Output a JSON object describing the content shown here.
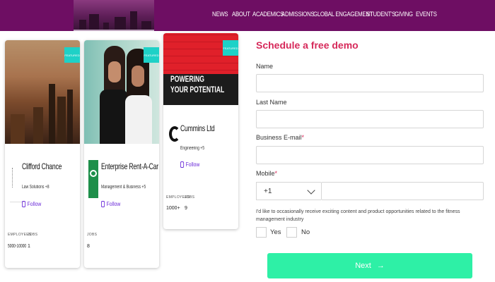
{
  "nav": {
    "items": [
      "NEWS",
      "ABOUT",
      "ACADEMICS",
      "ADMISSIONS",
      "GLOBAL ENGAGEMENT",
      "STUDENT'S",
      "GIVING",
      "EVENTS"
    ]
  },
  "cards": [
    {
      "badge": "FEATURED",
      "name": "Clifford Chance",
      "industry": "Law Solutions +8",
      "follow": "Follow",
      "meta_labels": [
        "EMPLOYEES",
        "JOBS"
      ],
      "meta_values": [
        "5000-10000",
        "1"
      ]
    },
    {
      "badge": "FEATURED",
      "name": "Enterprise Rent-A-Car",
      "industry": "Management & Business +5",
      "follow": "Follow",
      "meta_labels": [
        "JOBS"
      ],
      "meta_values": [
        "8"
      ]
    },
    {
      "badge": "FEATURED",
      "hero_text": [
        "POWERING",
        "YOUR POTENTIAL"
      ],
      "name": "Cummins Ltd",
      "industry": "Engineering +5",
      "follow": "Follow",
      "meta_labels": [
        "EMPLOYEES",
        "JOBS"
      ],
      "meta_values": [
        "1000+",
        "9"
      ]
    }
  ],
  "form": {
    "title": "Schedule a free demo",
    "name_label": "Name",
    "last_name_label": "Last Name",
    "email_label": "Business E-mail",
    "mobile_label": "Mobile",
    "required_mark": "*",
    "country_code": "+1",
    "consent_text": "I'd like to occasionally receive exciting content and product opportunities related to the fitness management industry",
    "yes_label": "Yes",
    "no_label": "No",
    "next_label": "Next",
    "next_arrow": "→"
  },
  "colors": {
    "topbar": "#6e0e63",
    "accent": "#d6295a",
    "badge": "#1ed1c7",
    "follow": "#6b2bd9",
    "next_button": "#2ef0a6"
  }
}
